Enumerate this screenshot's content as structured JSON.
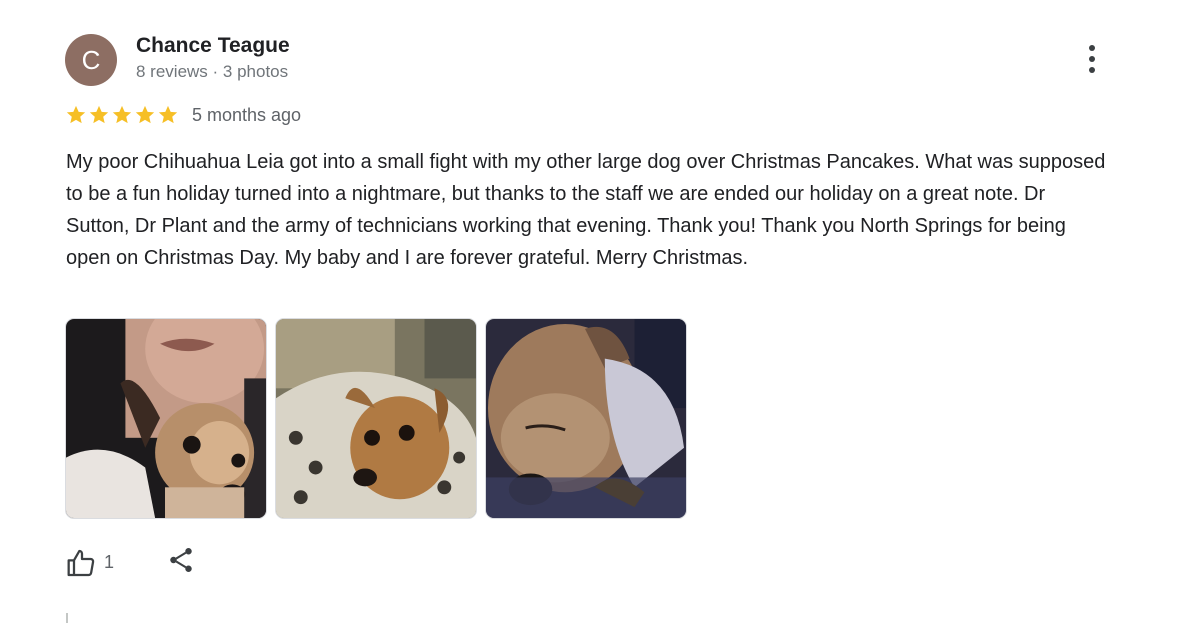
{
  "review": {
    "avatar_letter": "C",
    "avatar_color": "#8d6e63",
    "reviewer_name": "Chance Teague",
    "reviewer_meta": "8 reviews · 3 photos",
    "rating": 5,
    "rating_max": 5,
    "star_color": "#f6bf26",
    "time_ago": "5 months ago",
    "text": "My poor Chihuahua Leia got into a small fight with my other large dog over Christmas Pancakes. What was supposed to be a fun holiday turned into a nightmare, but thanks to the staff we are ended our holiday on a great note. Dr Sutton, Dr Plant and the army of technicians working that evening. Thank you! Thank you North Springs for being open on Christmas Day. My baby and I are forever grateful. Merry Christmas.",
    "photos": [
      {
        "subject": "man-holding-chihuahua"
      },
      {
        "subject": "chihuahua-in-paw-print-blanket"
      },
      {
        "subject": "chihuahua-sleeping-in-sweater"
      }
    ],
    "like_count": "1",
    "icons": {
      "more": "more-vert-icon",
      "like": "thumb-up-icon",
      "share": "share-icon"
    }
  }
}
